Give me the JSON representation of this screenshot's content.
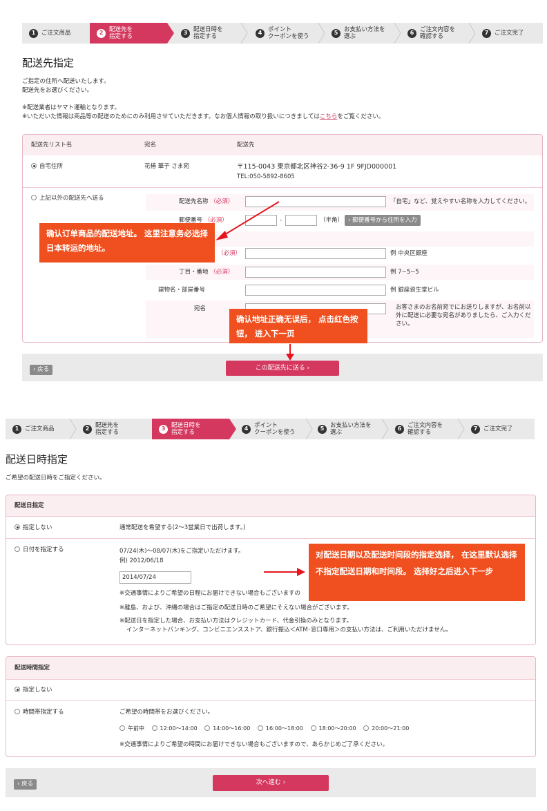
{
  "steps": [
    {
      "num": "1",
      "label": "ご注文商品"
    },
    {
      "num": "2",
      "label": "配送先を\n指定する"
    },
    {
      "num": "3",
      "label": "配送日時を\n指定する"
    },
    {
      "num": "4",
      "label": "ポイント\nクーポンを使う"
    },
    {
      "num": "5",
      "label": "お支払い方法を\n選ぶ"
    },
    {
      "num": "6",
      "label": "ご注文内容を\n確認する"
    },
    {
      "num": "7",
      "label": "ご注文完了"
    }
  ],
  "section1": {
    "title": "配送先指定",
    "intro1": "ご指定の住所へ配送いたします。",
    "intro2": "配送先をお選びください。",
    "note1": "※配送業者はヤマト運輸となります。",
    "note2_pre": "※いただいた情報は商品等の配送のためにのみ利用させていただきます。なお個人情報の取り扱いにつきましては",
    "note2_link": "こちら",
    "note2_post": "をご覧ください。",
    "table": {
      "col1": "配送先リスト名",
      "col2": "宛名",
      "col3": "配送先",
      "row1_name": "自宅住所",
      "row1_recipient": "花椿 華子 さま宛",
      "row1_address": "〒115-0043 東京都北区神谷2-36-9 1F 9FJD000001",
      "row1_tel": "TEL:050-5892-8605",
      "row2_name": "上記以外の配送先へ送る"
    },
    "form": {
      "name_label": "配送先名称",
      "required": "（必須）",
      "name_hint": "「自宅」など、覚えやすい名称を入力してください。",
      "zip_label": "郵便番号",
      "zip_dash": "-",
      "zip_hint": "（半角）",
      "zip_button": "› 郵便番号から住所を入力",
      "town_hint": "例 中央区銀座",
      "block_label": "丁目・番地",
      "block_hint": "例 7−5−5",
      "building_label": "建物名・部屋番号",
      "building_hint": "例 銀座資生堂ビル",
      "recipient_label": "宛名",
      "recipient_hint": "お客さまのお名前宛でにお送りしますが、お名前以外に配送に必要な宛名がありましたら、ご入力ください。"
    },
    "back": "‹ 戻る",
    "submit": "この配送先に送る ›"
  },
  "section2": {
    "title": "配送日時指定",
    "intro": "ご希望の配送日時をご指定ください。",
    "date_header": "配送日指定",
    "date_opt1": "指定しない",
    "date_opt1_desc": "通常配送を希望する(2〜3営業日で出荷します。)",
    "date_opt2": "日付を指定する",
    "date_range": "07/24(木)〜08/07(木)をご指定いただけます。",
    "date_example": "例) 2012/06/18",
    "date_value": "2014/07/24",
    "date_note1": "※交通事情によりご希望の日程にお届けできない場合もございますの",
    "date_note2": "※離島、および、沖縄の場合はご指定の配送日時のご希望にそえない場合がございます。",
    "date_note3": "※配送日を指定した場合、お支払い方法はクレジットカード、代金引換のみとなります。",
    "date_note4": "インターネットバンキング、コンビニエンスストア、銀行振込＜ATM･窓口専用＞の支払い方法は、ご利用いただけません。",
    "time_header": "配送時間指定",
    "time_opt1": "指定しない",
    "time_opt2": "時間帯指定する",
    "time_prompt": "ご希望の時間帯をお選びください。",
    "time_slots": [
      "午前中",
      "12:00〜14:00",
      "14:00〜16:00",
      "16:00〜18:00",
      "18:00〜20:00",
      "20:00〜21:00"
    ],
    "time_note": "※交通事情によりご希望の時間にお届けできない場合もございますので、あらかじめご了承ください。",
    "back": "‹ 戻る",
    "next": "次へ進む ›"
  },
  "annotations": {
    "callout1": "确认订单商品的配送地址。 这里注意务必选择日本转运的地址。",
    "callout2": "确认地址正确无误后， 点击红色按钮， 进入下一页",
    "callout3": "对配送日期以及配送时间段的指定选择， 在这里默认选择不指定配送日期和时间段。 选择好之后进入下一步"
  },
  "colors": {
    "accent": "#d4385f",
    "callout": "#f0501f",
    "border": "#e7b5c2"
  }
}
